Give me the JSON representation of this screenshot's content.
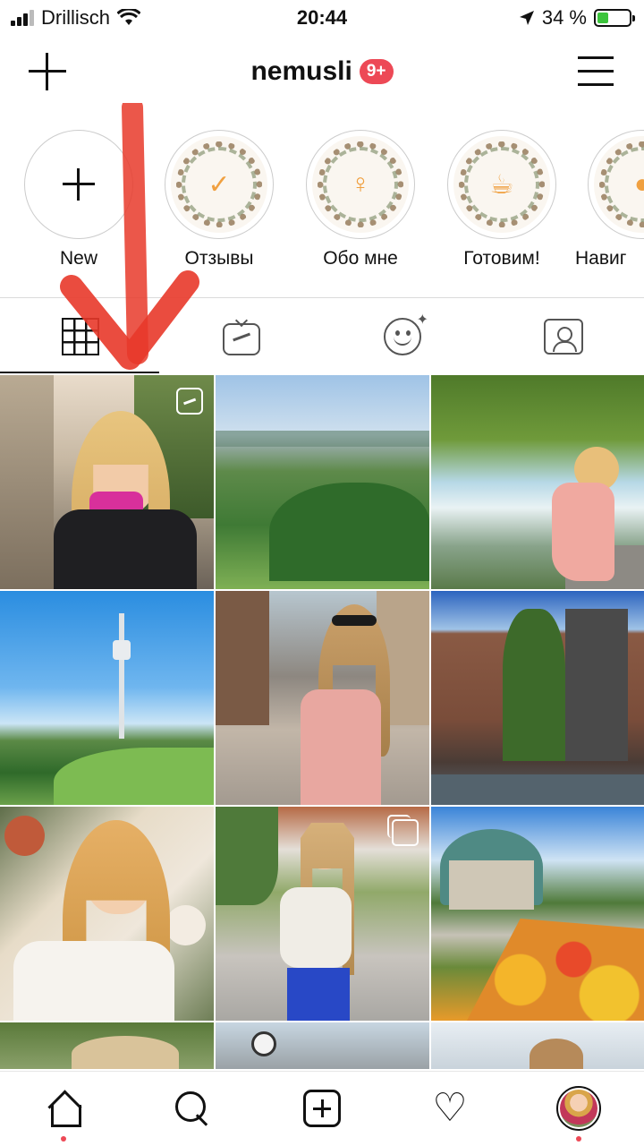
{
  "status_bar": {
    "carrier": "Drillisch",
    "time": "20:44",
    "battery_percent": "34 %",
    "battery_level": 0.34
  },
  "header": {
    "username": "nemusli",
    "notification_badge": "9+"
  },
  "highlights": [
    {
      "label": "New",
      "icon": "plus-icon"
    },
    {
      "label": "Отзывы",
      "icon": "checkmark-icon"
    },
    {
      "label": "Обо мне",
      "icon": "woman-figure-icon"
    },
    {
      "label": "Готовим!",
      "icon": "cooking-icon"
    },
    {
      "label": "Навиг",
      "icon": "map-pin-icon"
    }
  ],
  "tabs": [
    {
      "name": "grid",
      "icon": "grid-icon",
      "active": true
    },
    {
      "name": "igtv",
      "icon": "igtv-icon",
      "active": false
    },
    {
      "name": "effects",
      "icon": "face-effects-icon",
      "active": false
    },
    {
      "name": "tagged",
      "icon": "tagged-person-icon",
      "active": false
    }
  ],
  "posts": [
    {
      "subject": "woman-street-pink-scarf",
      "badge": "igtv"
    },
    {
      "subject": "green-hills-landscape",
      "badge": ""
    },
    {
      "subject": "woman-by-waterfall",
      "badge": ""
    },
    {
      "subject": "tv-tower-park",
      "badge": ""
    },
    {
      "subject": "woman-sunglasses-street",
      "badge": ""
    },
    {
      "subject": "amsterdam-houses-canal",
      "badge": ""
    },
    {
      "subject": "woman-floral-wall",
      "badge": ""
    },
    {
      "subject": "woman-white-jacket-street",
      "badge": "carousel"
    },
    {
      "subject": "pavilion-flower-garden",
      "badge": ""
    }
  ],
  "colors": {
    "notification_red": "#ed4956",
    "annotation_arrow": "#e8392a",
    "battery_green": "#3cc43c"
  },
  "bottom_nav": [
    {
      "name": "home",
      "icon": "home-icon",
      "has_dot": true
    },
    {
      "name": "search",
      "icon": "search-icon",
      "has_dot": false
    },
    {
      "name": "new-post",
      "icon": "add-post-icon",
      "has_dot": false
    },
    {
      "name": "activity",
      "icon": "heart-icon",
      "has_dot": false
    },
    {
      "name": "profile",
      "icon": "profile-avatar",
      "has_dot": true
    }
  ]
}
